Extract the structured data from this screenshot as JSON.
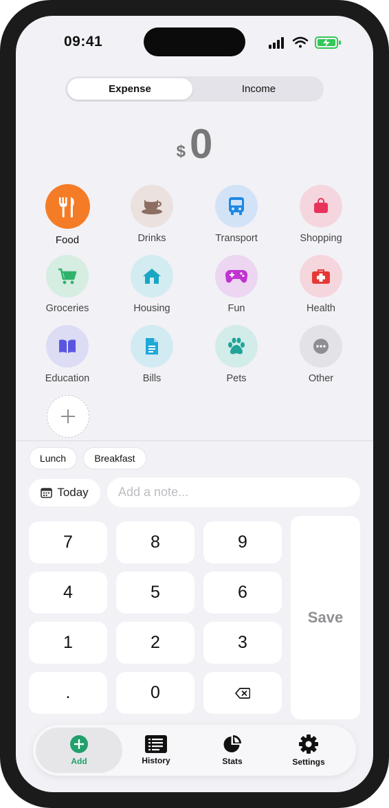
{
  "status_bar": {
    "time": "09:41"
  },
  "segment": {
    "options": [
      "Expense",
      "Income"
    ],
    "selected": "Expense"
  },
  "amount": {
    "currency": "$",
    "value": "0"
  },
  "categories": [
    {
      "label": "Food",
      "icon": "fork-knife-icon",
      "color": "#f57c27",
      "bg": "#f57c27",
      "selected": true
    },
    {
      "label": "Drinks",
      "icon": "coffee-cup-icon",
      "color": "#8d6e63",
      "bg": "#ebe1df"
    },
    {
      "label": "Transport",
      "icon": "bus-icon",
      "color": "#1e88e5",
      "bg": "#d3e3f7"
    },
    {
      "label": "Shopping",
      "icon": "shopping-bag-icon",
      "color": "#e8335b",
      "bg": "#f5d6df"
    },
    {
      "label": "Groceries",
      "icon": "shopping-cart-icon",
      "color": "#2fb36b",
      "bg": "#d6ede1"
    },
    {
      "label": "Housing",
      "icon": "house-icon",
      "color": "#19a6c4",
      "bg": "#d2ecf1"
    },
    {
      "label": "Fun",
      "icon": "gamepad-icon",
      "color": "#c134d1",
      "bg": "#ecd6f1"
    },
    {
      "label": "Health",
      "icon": "first-aid-kit-icon",
      "color": "#e53935",
      "bg": "#f5d6dc"
    },
    {
      "label": "Education",
      "icon": "book-icon",
      "color": "#5a55e0",
      "bg": "#dcdcf5"
    },
    {
      "label": "Bills",
      "icon": "document-icon",
      "color": "#1fa9d8",
      "bg": "#d2ebf3"
    },
    {
      "label": "Pets",
      "icon": "paw-icon",
      "color": "#20a49a",
      "bg": "#d2ece9"
    },
    {
      "label": "Other",
      "icon": "ellipsis-icon",
      "color": "#8e8e93",
      "bg": "#e3e3e7"
    }
  ],
  "quick_notes": [
    "Lunch",
    "Breakfast"
  ],
  "date_button": "Today",
  "note_placeholder": "Add a note...",
  "keypad": [
    "7",
    "8",
    "9",
    "4",
    "5",
    "6",
    "1",
    "2",
    "3",
    ".",
    "0",
    "backspace"
  ],
  "save_label": "Save",
  "tabs": [
    {
      "label": "Add",
      "icon": "plus-circle-icon",
      "active": true
    },
    {
      "label": "History",
      "icon": "list-icon"
    },
    {
      "label": "Stats",
      "icon": "pie-chart-icon"
    },
    {
      "label": "Settings",
      "icon": "gear-icon"
    }
  ],
  "colors": {
    "accent": "#22a06b",
    "food": "#f57c27",
    "background": "#f2f1f6"
  }
}
